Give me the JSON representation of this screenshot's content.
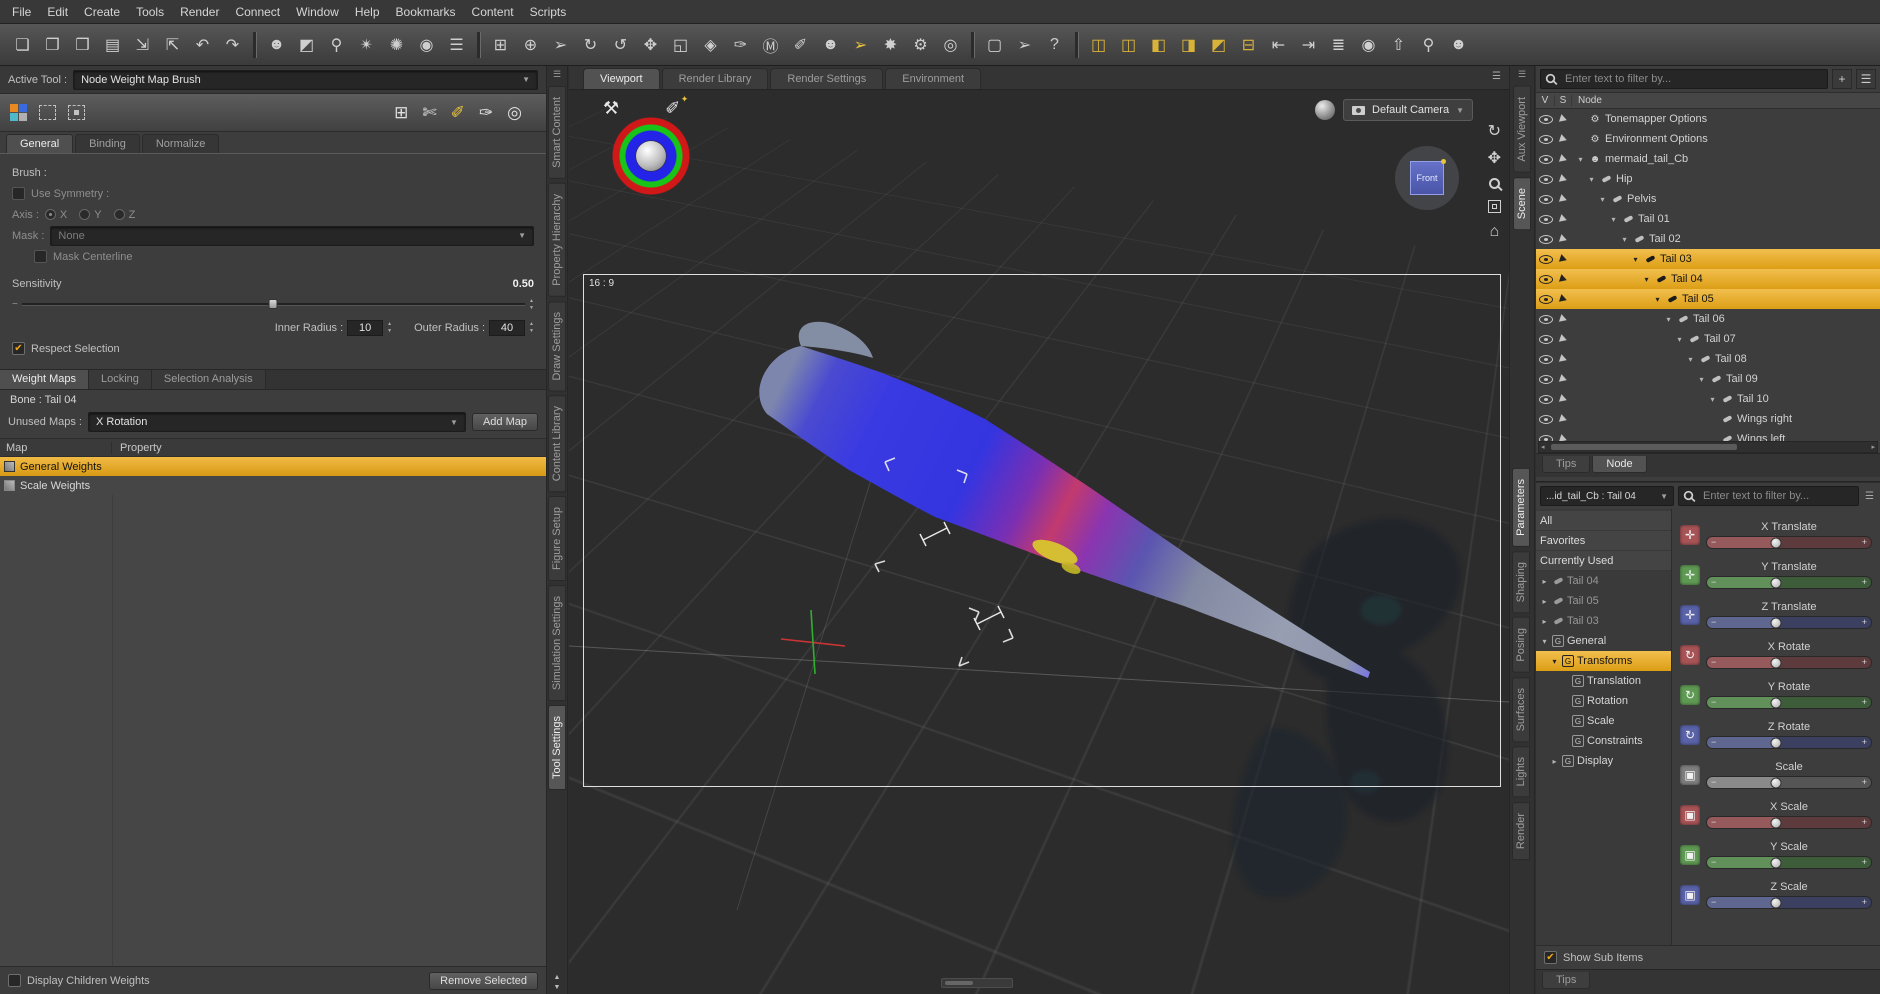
{
  "colors": {
    "accent": "#e9aa21",
    "panel": "#3d3d3d",
    "panel_dark": "#2e2e2e",
    "selection_gradient_top": "#f2bf4e",
    "selection_gradient_bottom": "#dc9e15"
  },
  "icons": {
    "chevron_down": "▼",
    "expand_down": "▾",
    "expand_right": "▸",
    "check": "✔",
    "menu": "☰",
    "plus": "+",
    "minus": "−",
    "up": "▲",
    "down": "▼",
    "left": "◂",
    "right": "▸",
    "home": "⌂",
    "pan": "✥",
    "orbit": "↻",
    "hammer": "⚒",
    "brush": "✐",
    "sparkle": "✦"
  },
  "menubar": {
    "items": [
      {
        "label": "File"
      },
      {
        "label": "Edit"
      },
      {
        "label": "Create"
      },
      {
        "label": "Tools"
      },
      {
        "label": "Render"
      },
      {
        "label": "Connect"
      },
      {
        "label": "Window"
      },
      {
        "label": "Help"
      },
      {
        "label": "Bookmarks"
      },
      {
        "label": "Content"
      },
      {
        "label": "Scripts"
      }
    ]
  },
  "toolbar": {
    "icons": [
      {
        "name": "new-file",
        "glyph": "❏"
      },
      {
        "name": "open-file",
        "glyph": "❐"
      },
      {
        "name": "save-as",
        "glyph": "❒"
      },
      {
        "name": "save",
        "glyph": "▤"
      },
      {
        "name": "import",
        "glyph": "⇲"
      },
      {
        "name": "export",
        "glyph": "⇱"
      },
      {
        "name": "undo",
        "glyph": "↶"
      },
      {
        "name": "redo",
        "glyph": "↷"
      },
      {
        "name": "separator",
        "sep": true
      },
      {
        "name": "create-figure",
        "glyph": "☻"
      },
      {
        "name": "create-prop",
        "glyph": "◩"
      },
      {
        "name": "create-magnet",
        "glyph": "⚲"
      },
      {
        "name": "create-deformer",
        "glyph": "✴"
      },
      {
        "name": "create-light",
        "glyph": "✺"
      },
      {
        "name": "create-camera",
        "glyph": "◉"
      },
      {
        "name": "pane-menu",
        "glyph": "☰"
      },
      {
        "name": "separator",
        "sep": true
      },
      {
        "name": "grid-snap",
        "glyph": "⊞"
      },
      {
        "name": "aim-at",
        "glyph": "⊕"
      },
      {
        "name": "node-selection-tool",
        "glyph": "➢"
      },
      {
        "name": "rotate-tool",
        "glyph": "↻"
      },
      {
        "name": "orbit-tool",
        "glyph": "↺"
      },
      {
        "name": "translate-tool",
        "glyph": "✥"
      },
      {
        "name": "scale-tool",
        "glyph": "◱"
      },
      {
        "name": "universal-tool",
        "glyph": "◈"
      },
      {
        "name": "surface-selection-tool",
        "glyph": "✑"
      },
      {
        "name": "geometry-editor-tool",
        "glyph": "Ⓜ"
      },
      {
        "name": "brush-tool",
        "glyph": "✐"
      },
      {
        "name": "figure-tool",
        "glyph": "☻"
      },
      {
        "name": "node-weight-brush-tool",
        "glyph": "➢",
        "tint": "#ecc43c"
      },
      {
        "name": "spot-render-tool",
        "glyph": "✸"
      },
      {
        "name": "render-settings",
        "glyph": "⚙"
      },
      {
        "name": "camera-tool",
        "glyph": "◎"
      },
      {
        "name": "separator",
        "sep": true
      },
      {
        "name": "content-case",
        "glyph": "▢"
      },
      {
        "name": "whats-this-pointer",
        "glyph": "➢"
      },
      {
        "name": "help",
        "glyph": "?"
      },
      {
        "name": "separator",
        "sep": true
      },
      {
        "name": "scene-tools-layout-1",
        "glyph": "◫",
        "tint": "#d9b23a"
      },
      {
        "name": "scene-tools-layout-2",
        "glyph": "◫",
        "tint": "#d9b23a"
      },
      {
        "name": "scene-tools-layout-3",
        "glyph": "◧",
        "tint": "#d9b23a"
      },
      {
        "name": "scene-tools-layout-4",
        "glyph": "◨",
        "tint": "#d9b23a"
      },
      {
        "name": "scene-tools-layout-5",
        "glyph": "◩",
        "tint": "#d9b23a"
      },
      {
        "name": "scene-tools-layout-6",
        "glyph": "⊟",
        "tint": "#d9b23a"
      },
      {
        "name": "dock-left",
        "glyph": "⇤"
      },
      {
        "name": "dock-right",
        "glyph": "⇥"
      },
      {
        "name": "timeline-bars",
        "glyph": "≣"
      },
      {
        "name": "show-hide-all",
        "glyph": "◉"
      },
      {
        "name": "pose-arrow",
        "glyph": "⇧"
      },
      {
        "name": "search",
        "glyph": "⚲"
      },
      {
        "name": "user",
        "glyph": "☻"
      }
    ]
  },
  "tool_panel": {
    "active_tool_label": "Active Tool :",
    "active_tool_value": "Node Weight Map Brush",
    "tabs": [
      {
        "label": "General",
        "active": true
      },
      {
        "label": "Binding"
      },
      {
        "label": "Normalize"
      }
    ],
    "brush_label": "Brush :",
    "use_symmetry_label": "Use Symmetry :",
    "axis_label": "Axis :",
    "axis_options": [
      {
        "label": "X",
        "on": true
      },
      {
        "label": "Y"
      },
      {
        "label": "Z"
      }
    ],
    "mask_label": "Mask :",
    "mask_value": "None",
    "mask_centerline_label": "Mask Centerline",
    "sensitivity_label": "Sensitivity",
    "sensitivity_value": "0.50",
    "inner_radius_label": "Inner Radius :",
    "inner_radius_value": "10",
    "outer_radius_label": "Outer Radius :",
    "outer_radius_value": "40",
    "respect_selection_label": "Respect Selection",
    "map_tabs": [
      {
        "label": "Weight Maps",
        "active": true
      },
      {
        "label": "Locking"
      },
      {
        "label": "Selection Analysis"
      }
    ],
    "bone_label": "Bone : Tail 04",
    "unused_maps_label": "Unused Maps :",
    "unused_maps_value": "X Rotation",
    "add_map_label": "Add Map",
    "table": {
      "columns": [
        {
          "label": "Map"
        },
        {
          "label": "Property"
        }
      ],
      "rows": [
        {
          "label": "General Weights",
          "selected": true
        },
        {
          "label": "Scale Weights"
        }
      ]
    },
    "display_children_label": "Display Children Weights",
    "remove_selected_label": "Remove Selected"
  },
  "left_dock_tabs": [
    {
      "label": "Smart Content"
    },
    {
      "label": "Property Hierarchy"
    },
    {
      "label": "Draw Settings"
    },
    {
      "label": "Content Library"
    },
    {
      "label": "Figure Setup"
    },
    {
      "label": "Simulation Settings"
    },
    {
      "label": "Tool Settings",
      "active": true
    }
  ],
  "viewport": {
    "tabs": [
      {
        "label": "Viewport",
        "active": true
      },
      {
        "label": "Render Library"
      },
      {
        "label": "Render Settings"
      },
      {
        "label": "Environment"
      }
    ],
    "aspect_label": "16 : 9",
    "camera_selector": "Default Camera",
    "view_cube_label": "Front"
  },
  "right_dock_tabs_top": [
    {
      "label": "Aux Viewport"
    },
    {
      "label": "Scene",
      "active": true
    }
  ],
  "right_dock_tabs_bottom": [
    {
      "label": "Parameters",
      "active": true
    },
    {
      "label": "Shaping"
    },
    {
      "label": "Posing"
    },
    {
      "label": "Surfaces"
    },
    {
      "label": "Lights"
    },
    {
      "label": "Render"
    }
  ],
  "scene_panel": {
    "filter_placeholder": "Enter text to filter by...",
    "columns": {
      "v": "V",
      "s": "S",
      "node": "Node"
    },
    "nodes": [
      {
        "label": "Tonemapper Options",
        "icon": "gear",
        "indent": 0,
        "exp": ""
      },
      {
        "label": "Environment Options",
        "icon": "gear",
        "indent": 0,
        "exp": ""
      },
      {
        "label": "mermaid_tail_Cb",
        "icon": "figure",
        "indent": 0,
        "exp": "▾"
      },
      {
        "label": "Hip",
        "icon": "bone",
        "indent": 1,
        "exp": "▾"
      },
      {
        "label": "Pelvis",
        "icon": "bone",
        "indent": 2,
        "exp": "▾"
      },
      {
        "label": "Tail 01",
        "icon": "bone",
        "indent": 3,
        "exp": "▾"
      },
      {
        "label": "Tail 02",
        "icon": "bone",
        "indent": 4,
        "exp": "▾"
      },
      {
        "label": "Tail 03",
        "icon": "bone",
        "indent": 5,
        "exp": "▾",
        "selected": true
      },
      {
        "label": "Tail 04",
        "icon": "bone",
        "indent": 6,
        "exp": "▾",
        "selected": true
      },
      {
        "label": "Tail 05",
        "icon": "bone",
        "indent": 7,
        "exp": "▾",
        "selected": true
      },
      {
        "label": "Tail 06",
        "icon": "bone",
        "indent": 8,
        "exp": "▾"
      },
      {
        "label": "Tail 07",
        "icon": "bone",
        "indent": 9,
        "exp": "▾"
      },
      {
        "label": "Tail 08",
        "icon": "bone",
        "indent": 10,
        "exp": "▾"
      },
      {
        "label": "Tail 09",
        "icon": "bone",
        "indent": 11,
        "exp": "▾"
      },
      {
        "label": "Tail 10",
        "icon": "bone",
        "indent": 12,
        "exp": "▾"
      },
      {
        "label": "Wings right",
        "icon": "bone",
        "indent": 12,
        "exp": ""
      },
      {
        "label": "Wings left",
        "icon": "bone",
        "indent": 12,
        "exp": ""
      }
    ],
    "bottom_tabs": [
      {
        "label": "Tips"
      },
      {
        "label": "Node",
        "active": true
      }
    ]
  },
  "params_panel": {
    "node_selector": "...id_tail_Cb : Tail 04",
    "filter_placeholder": "Enter text to filter by...",
    "nav": [
      {
        "label": "All",
        "type": "plain"
      },
      {
        "label": "Favorites",
        "type": "plain"
      },
      {
        "label": "Currently Used",
        "type": "plain"
      },
      {
        "label": "Tail 04",
        "type": "bone",
        "dim": true,
        "exp": "▸"
      },
      {
        "label": "Tail 05",
        "type": "bone",
        "dim": true,
        "exp": "▸"
      },
      {
        "label": "Tail 03",
        "type": "bone",
        "dim": true,
        "exp": "▸"
      },
      {
        "label": "General",
        "type": "group",
        "exp": "▾",
        "indent": 0
      },
      {
        "label": "Transforms",
        "type": "group",
        "exp": "▾",
        "indent": 1,
        "selected": true
      },
      {
        "label": "Translation",
        "type": "group",
        "exp": "",
        "indent": 2
      },
      {
        "label": "Rotation",
        "type": "group",
        "exp": "",
        "indent": 2
      },
      {
        "label": "Scale",
        "type": "group",
        "exp": "",
        "indent": 2
      },
      {
        "label": "Constraints",
        "type": "group",
        "exp": "",
        "indent": 2
      },
      {
        "label": "Display",
        "type": "group",
        "exp": "▸",
        "indent": 1
      }
    ],
    "sliders": [
      {
        "label": "X Translate",
        "kind": "translate",
        "icon_bg": "#a85456",
        "fill": "#96595c",
        "empty": "#5d3a3c"
      },
      {
        "label": "Y Translate",
        "kind": "translate",
        "icon_bg": "#5f9a54",
        "fill": "#62905a",
        "empty": "#3d5c39"
      },
      {
        "label": "Z Translate",
        "kind": "translate",
        "icon_bg": "#5a62a8",
        "fill": "#5f668f",
        "empty": "#3b4060"
      },
      {
        "label": "X Rotate",
        "kind": "rotate",
        "icon_bg": "#a85456",
        "fill": "#96595c",
        "empty": "#5d3a3c"
      },
      {
        "label": "Y Rotate",
        "kind": "rotate",
        "icon_bg": "#5f9a54",
        "fill": "#62905a",
        "empty": "#3d5c39"
      },
      {
        "label": "Z Rotate",
        "kind": "rotate",
        "icon_bg": "#5a62a8",
        "fill": "#5f668f",
        "empty": "#3b4060"
      },
      {
        "label": "Scale",
        "kind": "scale",
        "icon_bg": "#7f7f7f",
        "fill": "#8a8a8a",
        "empty": "#555555"
      },
      {
        "label": "X Scale",
        "kind": "scale",
        "icon_bg": "#a85456",
        "fill": "#96595c",
        "empty": "#5d3a3c"
      },
      {
        "label": "Y Scale",
        "kind": "scale",
        "icon_bg": "#5f9a54",
        "fill": "#62905a",
        "empty": "#3d5c39"
      },
      {
        "label": "Z Scale",
        "kind": "scale",
        "icon_bg": "#5a62a8",
        "fill": "#5f668f",
        "empty": "#3b4060"
      }
    ],
    "show_sub_items_label": "Show Sub Items",
    "bottom_tab": "Tips"
  }
}
